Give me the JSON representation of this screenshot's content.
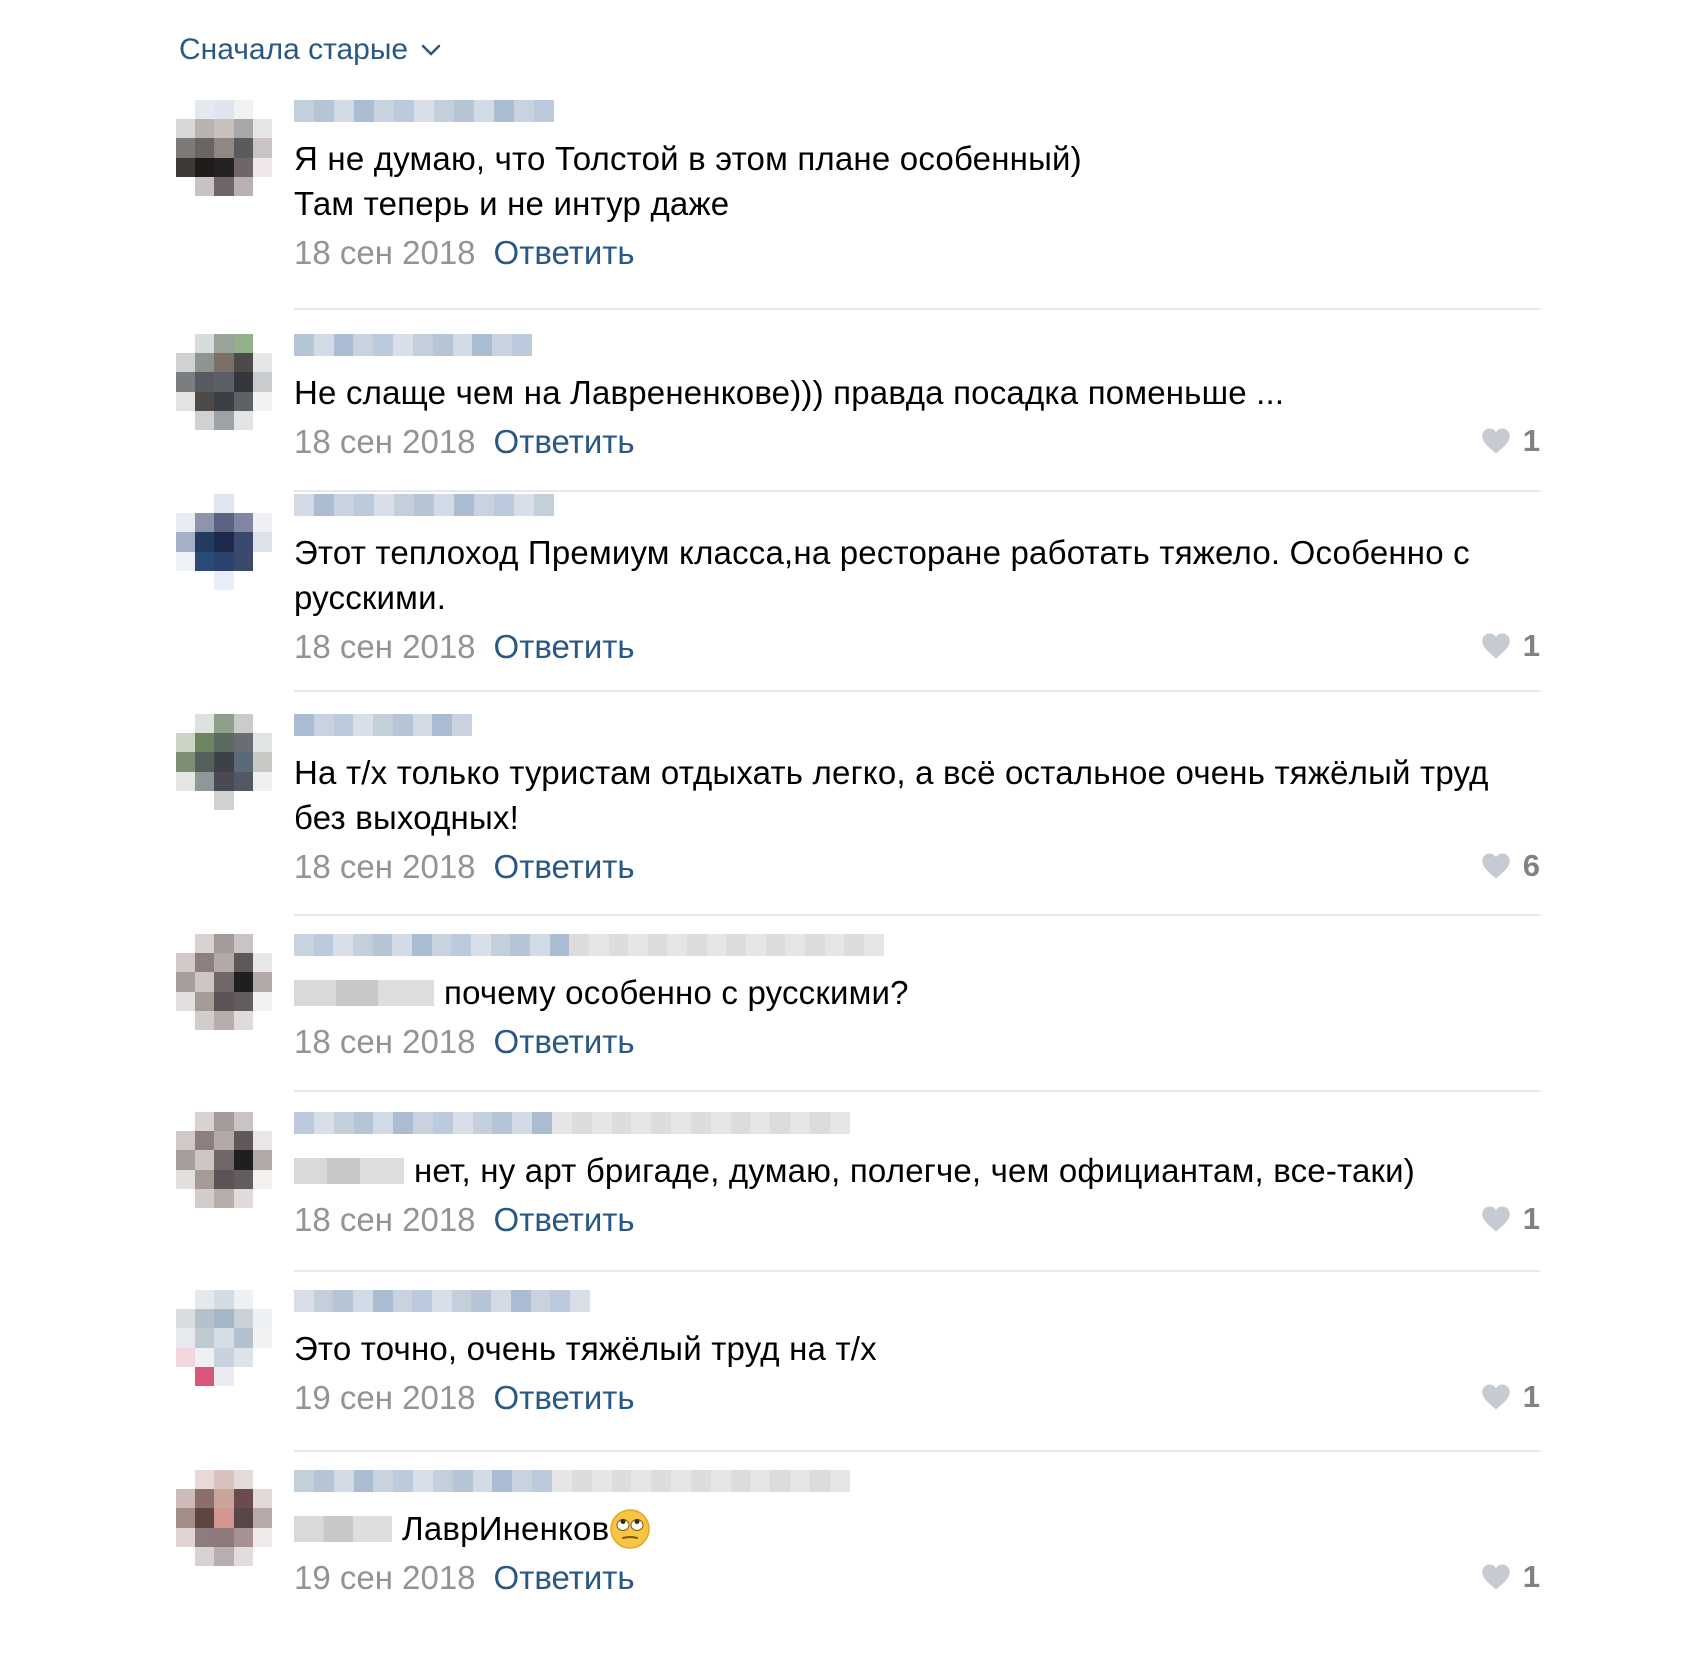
{
  "sort": {
    "label": "Сначала старые"
  },
  "colors": {
    "link": "#2a5885",
    "date": "#939393",
    "like": "#828282",
    "separator": "#e7e8ec"
  },
  "reply_label": "Ответить",
  "comments": [
    {
      "text": "Я не думаю, что Толстой в этом плане особенный)\nТам теперь и не интур даже",
      "date": "18 сен 2018",
      "likes": ""
    },
    {
      "text": "Не слаще чем на Лаврененкове))) правда посадка поменьше ...",
      "date": "18 сен 2018",
      "likes": "1"
    },
    {
      "text": "Этот теплоход Премиум класса,на ресторане работать тяжело. Особенно с русскими.",
      "date": "18 сен 2018",
      "likes": "1"
    },
    {
      "text": "На т/х только туристам отдыхать легко, а всё остальное очень тяжёлый труд без выходных!",
      "date": "18 сен 2018",
      "likes": "6"
    },
    {
      "text": "почему особенно с русскими?",
      "date": "18 сен 2018",
      "likes": ""
    },
    {
      "text": "нет, ну арт бригаде, думаю, полегче, чем официантам, все-таки)",
      "date": "18 сен 2018",
      "likes": "1"
    },
    {
      "text": "Это точно, очень тяжёлый труд на т/х",
      "date": "19 сен 2018",
      "likes": "1"
    },
    {
      "text": "ЛаврИненков",
      "date": "19 сен 2018",
      "likes": "1",
      "emoji": "rolling-eyes-emoji"
    }
  ]
}
